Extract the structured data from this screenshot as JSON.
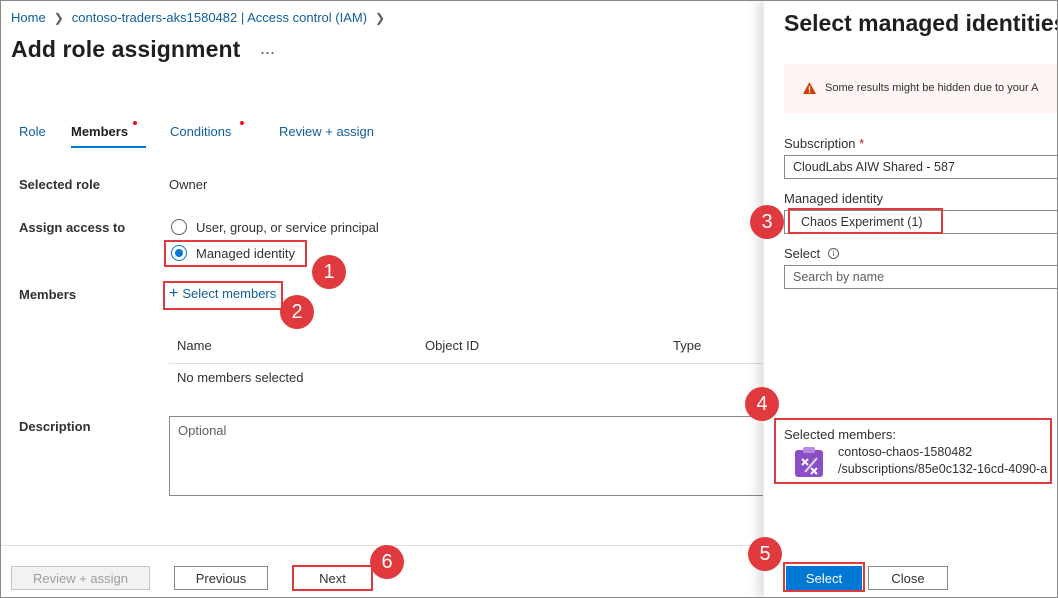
{
  "breadcrumb": {
    "home": "Home",
    "resource": "contoso-traders-aks1580482 | Access control (IAM)"
  },
  "page": {
    "title": "Add role assignment",
    "more": "..."
  },
  "tabs": [
    {
      "label": "Role"
    },
    {
      "label": "Members"
    },
    {
      "label": "Conditions"
    },
    {
      "label": "Review + assign"
    }
  ],
  "form": {
    "selected_role_label": "Selected role",
    "selected_role_value": "Owner",
    "assign_access_label": "Assign access to",
    "option_user": "User, group, or service principal",
    "option_managed": "Managed identity",
    "members_label": "Members",
    "select_members": "Select members",
    "table_headers": [
      "Name",
      "Object ID",
      "Type"
    ],
    "empty_text": "No members selected",
    "description_label": "Description",
    "description_placeholder": "Optional"
  },
  "footer": {
    "review_assign": "Review + assign",
    "previous": "Previous",
    "next": "Next"
  },
  "panel": {
    "title": "Select managed identities",
    "warning": "Some results might be hidden due to your A",
    "subscription_label": "Subscription",
    "subscription_value": "CloudLabs AIW Shared - 587",
    "managed_identity_label": "Managed identity",
    "managed_identity_value": "Chaos Experiment (1)",
    "select_label": "Select",
    "search_placeholder": "Search by name",
    "selected_members_label": "Selected members:",
    "member_name": "contoso-chaos-1580482",
    "member_path": "/subscriptions/85e0c132-16cd-4090-a",
    "select_button": "Select",
    "close_button": "Close"
  },
  "callouts": [
    "1",
    "2",
    "3",
    "4",
    "5",
    "6"
  ],
  "colors": {
    "accent": "#0078d4",
    "link": "#0f5e9c",
    "callout": "#e0393e",
    "warning": "#d83b01",
    "identity_icon": "#8a4fc7"
  },
  "icons": {
    "breadcrumb_separator": "chevron-right-icon",
    "add": "plus-icon",
    "warning": "warning-icon",
    "info": "info-icon",
    "identity": "managed-identity-icon"
  }
}
